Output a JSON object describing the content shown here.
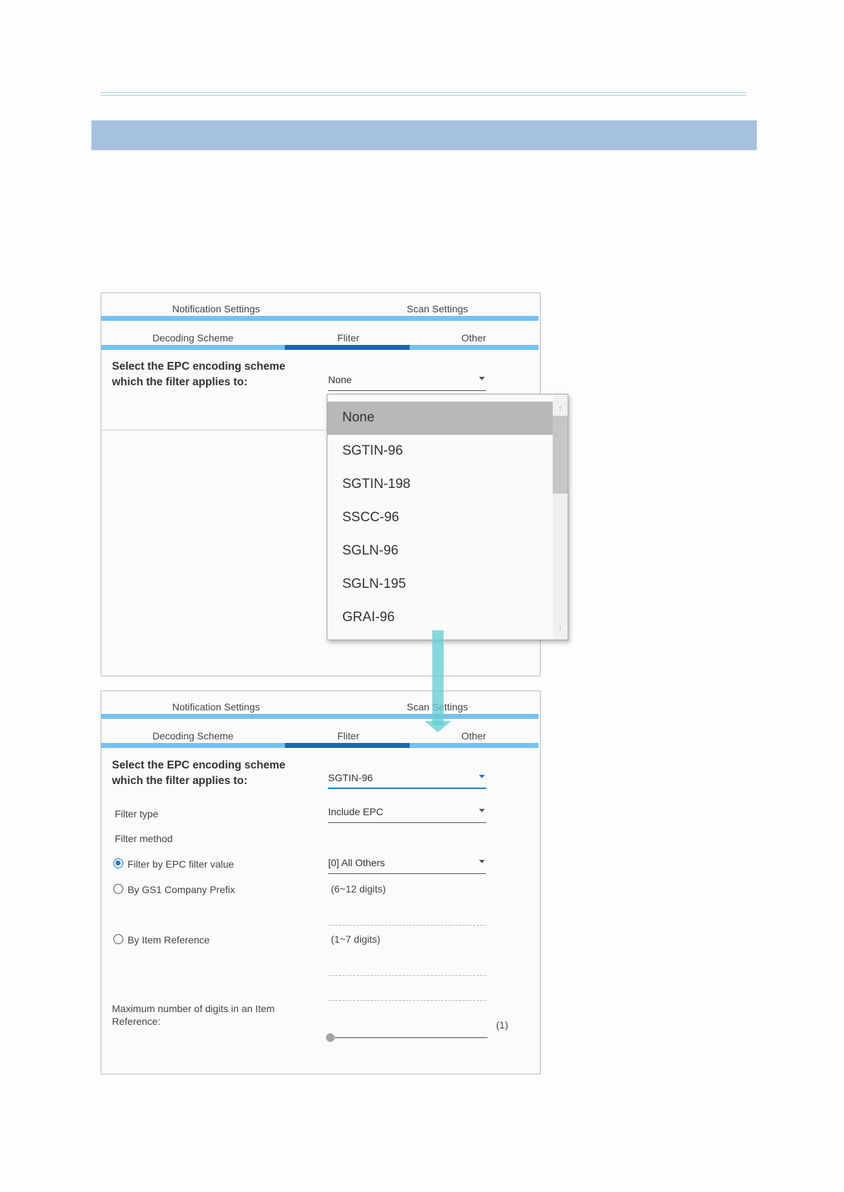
{
  "tabs_top": {
    "notification": "Notification Settings",
    "scan": "Scan Settings"
  },
  "tabs_sub": {
    "decoding": "Decoding Scheme",
    "filter": "Fliter",
    "other": "Other"
  },
  "panel1": {
    "encoding_label_line1": "Select the EPC encoding scheme",
    "encoding_label_line2": "which the filter applies to:",
    "encoding_value": "None"
  },
  "dropdown": {
    "items": [
      "None",
      "SGTIN-96",
      "SGTIN-198",
      "SSCC-96",
      "SGLN-96",
      "SGLN-195",
      "GRAI-96"
    ],
    "selected": "None"
  },
  "panel2": {
    "encoding_label_line1": "Select the EPC encoding scheme",
    "encoding_label_line2": "which the filter applies to:",
    "encoding_value": "SGTIN-96",
    "filter_type_label": "Filter type",
    "filter_type_value": "Include EPC",
    "filter_method_label": "Filter method",
    "radio_epc_label": "Filter by EPC filter value",
    "epc_filter_value": "[0] All Others",
    "radio_gs1_label": "By GS1 Company Prefix",
    "gs1_hint": "(6~12 digits)",
    "radio_item_label": "By Item Reference",
    "item_hint": "(1~7 digits)",
    "max_digits_label_line1": "Maximum number of digits in an Item",
    "max_digits_label_line2": "Reference:",
    "max_digits_value": "(1)"
  },
  "colors": {
    "banner": "#a6c0e0",
    "tab_bar": "#74c2f2",
    "tab_active": "#1a66b0",
    "accent": "#1b7ac9",
    "arrow": "#67ced4"
  }
}
